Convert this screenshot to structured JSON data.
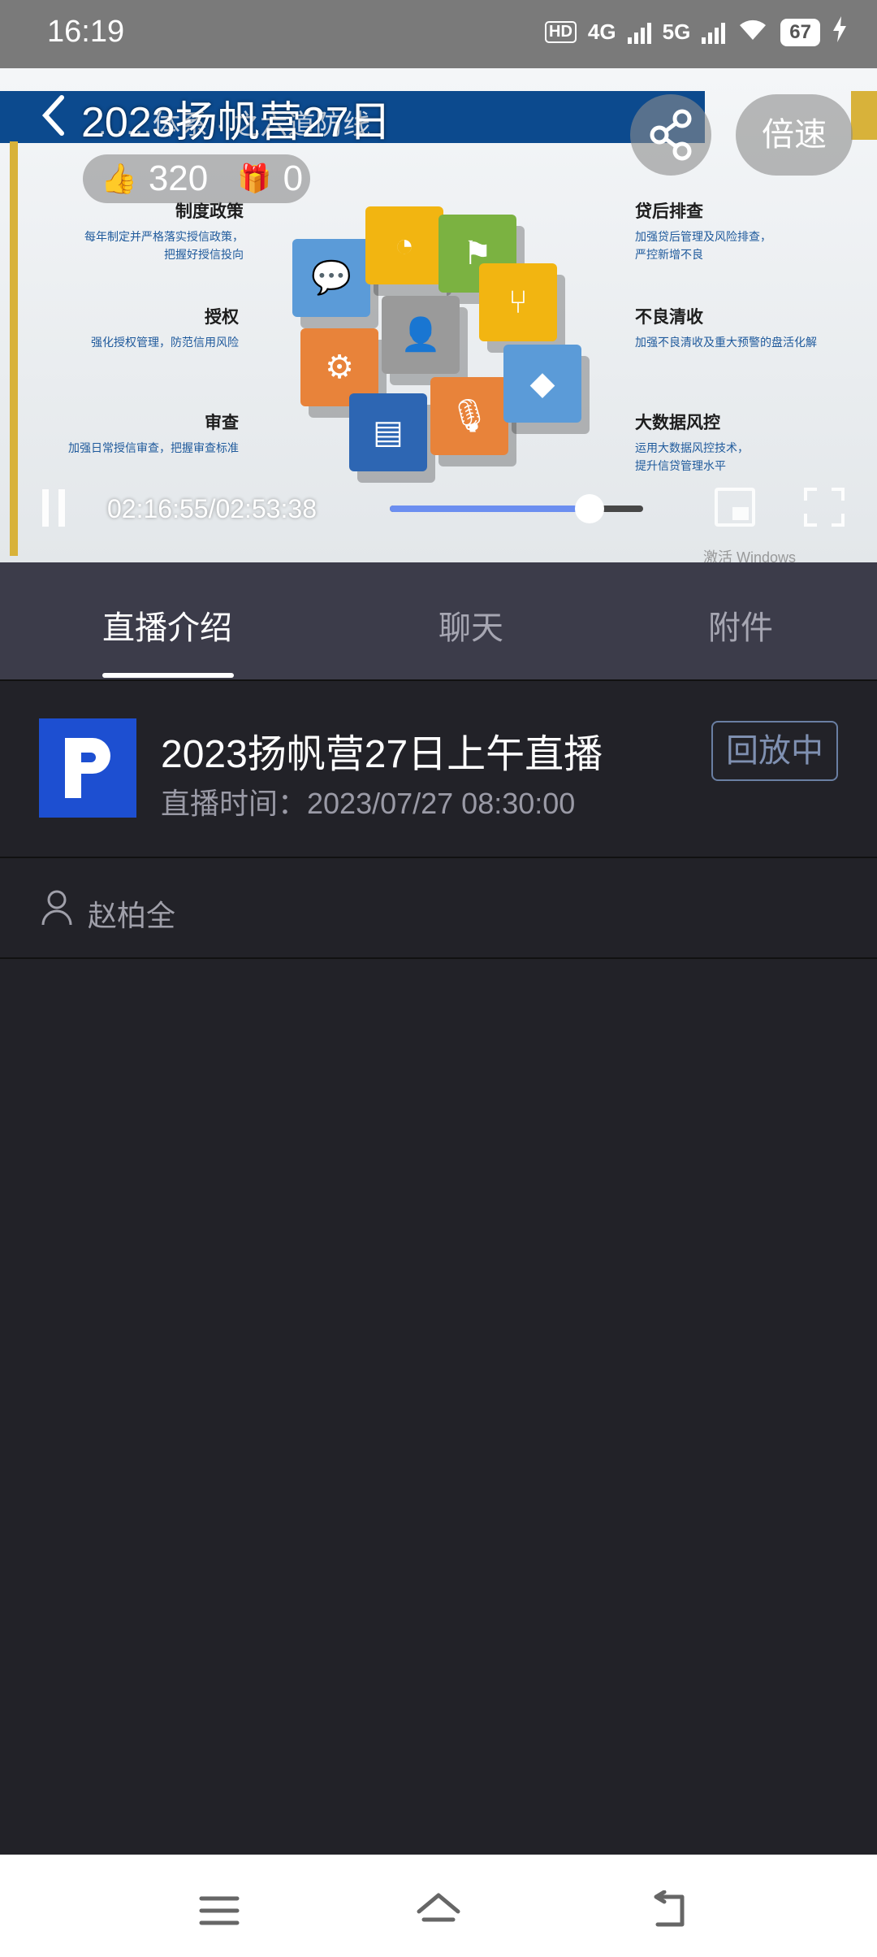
{
  "status": {
    "time": "16:19",
    "network_hd": "HD",
    "net1": "4G",
    "net2": "5G",
    "battery": "67"
  },
  "video": {
    "title": "2023扬帆营27日",
    "slide_banner": "……体系 · 之六道防线",
    "likes": "320",
    "gifts": "0",
    "speed_label": "倍速",
    "time_display": "02:16:55/02:53:38",
    "progress": 0.79,
    "slide_items": [
      {
        "title": "制度政策",
        "desc": "每年制定并严格落实授信政策，\n把握好授信投向"
      },
      {
        "title": "授权",
        "desc": "强化授权管理，防范信用风险"
      },
      {
        "title": "审查",
        "desc": "加强日常授信审查，把握审查标准"
      },
      {
        "title": "贷后排查",
        "desc": "加强贷后管理及风险排查，\n严控新增不良"
      },
      {
        "title": "不良清收",
        "desc": "加强不良清收及重大预警的盘活化解"
      },
      {
        "title": "大数据风控",
        "desc": "运用大数据风控技术，\n提升信贷管理水平"
      }
    ],
    "watermark": "激活 Windows\n转到\"设置\"以激活 Windows。"
  },
  "tabs": [
    {
      "label": "直播介绍",
      "active": true
    },
    {
      "label": "聊天",
      "active": false
    },
    {
      "label": "附件",
      "active": false
    }
  ],
  "live": {
    "title": "2023扬帆营27日上午直播",
    "time_label": "直播时间：2023/07/27 08:30:00",
    "badge": "回放中"
  },
  "host": {
    "name": "赵柏全"
  },
  "colors": {
    "accent": "#6b8ef0",
    "logo_bg": "#1d4fd1",
    "tab_bar": "#3c3c4a",
    "page_bg": "#222228"
  }
}
